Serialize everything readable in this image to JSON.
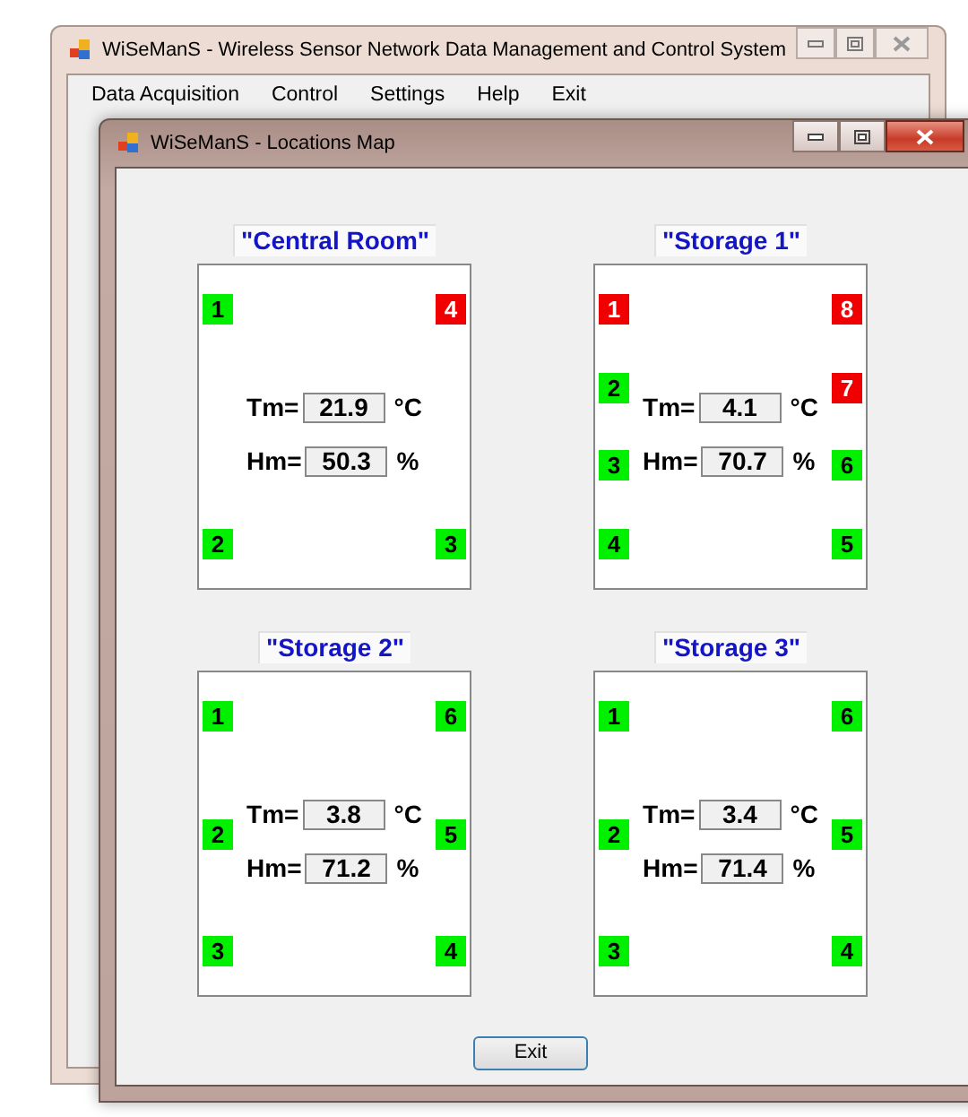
{
  "main_window": {
    "title": "WiSeManS - Wireless Sensor Network Data Management and Control System",
    "menu": [
      "Data Acquisition",
      "Control",
      "Settings",
      "Help",
      "Exit"
    ]
  },
  "map_window": {
    "title": "WiSeManS - Locations Map",
    "rooms": [
      {
        "name": "\"Central Room\"",
        "temp_label": "Tm=",
        "temperature": "21.9",
        "temp_unit": "°C",
        "hum_label": "Hm=",
        "humidity": "50.3",
        "hum_unit": "%",
        "left_sensors": [
          {
            "label": "1",
            "alarm": false
          },
          {
            "label": "2",
            "alarm": false
          }
        ],
        "right_sensors": [
          {
            "label": "4",
            "alarm": true
          },
          {
            "label": "3",
            "alarm": false
          }
        ]
      },
      {
        "name": "\"Storage 1\"",
        "temp_label": "Tm=",
        "temperature": "4.1",
        "temp_unit": "°C",
        "hum_label": "Hm=",
        "humidity": "70.7",
        "hum_unit": "%",
        "left_sensors": [
          {
            "label": "1",
            "alarm": true
          },
          {
            "label": "2",
            "alarm": false
          },
          {
            "label": "3",
            "alarm": false
          },
          {
            "label": "4",
            "alarm": false
          }
        ],
        "right_sensors": [
          {
            "label": "8",
            "alarm": true
          },
          {
            "label": "7",
            "alarm": true
          },
          {
            "label": "6",
            "alarm": false
          },
          {
            "label": "5",
            "alarm": false
          }
        ]
      },
      {
        "name": "\"Storage 2\"",
        "temp_label": "Tm=",
        "temperature": "3.8",
        "temp_unit": "°C",
        "hum_label": "Hm=",
        "humidity": "71.2",
        "hum_unit": "%",
        "left_sensors": [
          {
            "label": "1",
            "alarm": false
          },
          {
            "label": "2",
            "alarm": false
          },
          {
            "label": "3",
            "alarm": false
          }
        ],
        "right_sensors": [
          {
            "label": "6",
            "alarm": false
          },
          {
            "label": "5",
            "alarm": false
          },
          {
            "label": "4",
            "alarm": false
          }
        ]
      },
      {
        "name": "\"Storage 3\"",
        "temp_label": "Tm=",
        "temperature": "3.4",
        "temp_unit": "°C",
        "hum_label": "Hm=",
        "humidity": "71.4",
        "hum_unit": "%",
        "left_sensors": [
          {
            "label": "1",
            "alarm": false
          },
          {
            "label": "2",
            "alarm": false
          },
          {
            "label": "3",
            "alarm": false
          }
        ],
        "right_sensors": [
          {
            "label": "6",
            "alarm": false
          },
          {
            "label": "5",
            "alarm": false
          },
          {
            "label": "4",
            "alarm": false
          }
        ]
      }
    ],
    "exit_button": "Exit"
  }
}
